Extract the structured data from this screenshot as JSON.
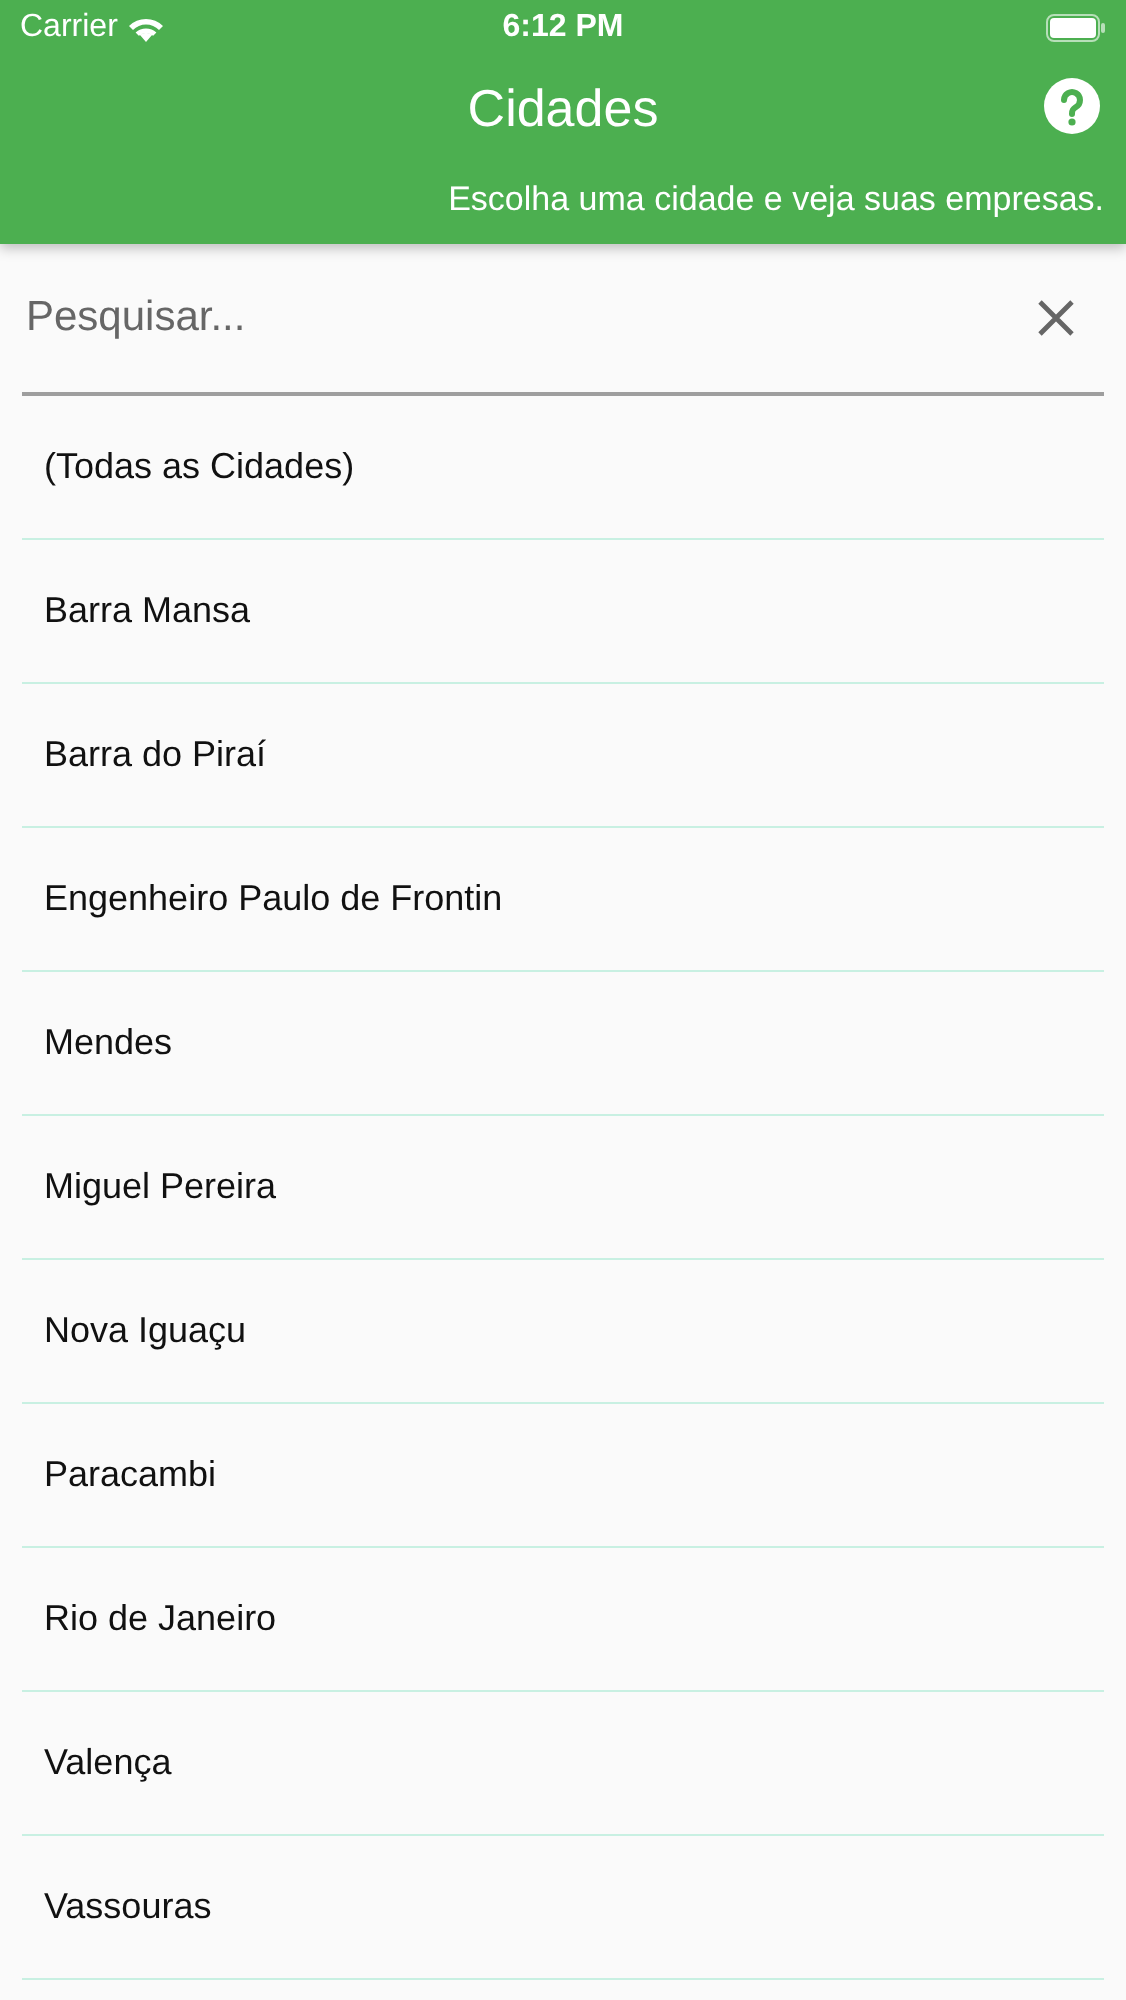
{
  "status_bar": {
    "carrier": "Carrier",
    "time": "6:12 PM"
  },
  "header": {
    "title": "Cidades",
    "subtitle": "Escolha uma cidade e veja suas empresas."
  },
  "search": {
    "placeholder": "Pesquisar..."
  },
  "cities": [
    "(Todas as Cidades)",
    "Barra Mansa",
    "Barra do Piraí",
    "Engenheiro Paulo de Frontin",
    "Mendes",
    "Miguel Pereira",
    "Nova Iguaçu",
    "Paracambi",
    "Rio de Janeiro",
    "Valença",
    "Vassouras"
  ]
}
